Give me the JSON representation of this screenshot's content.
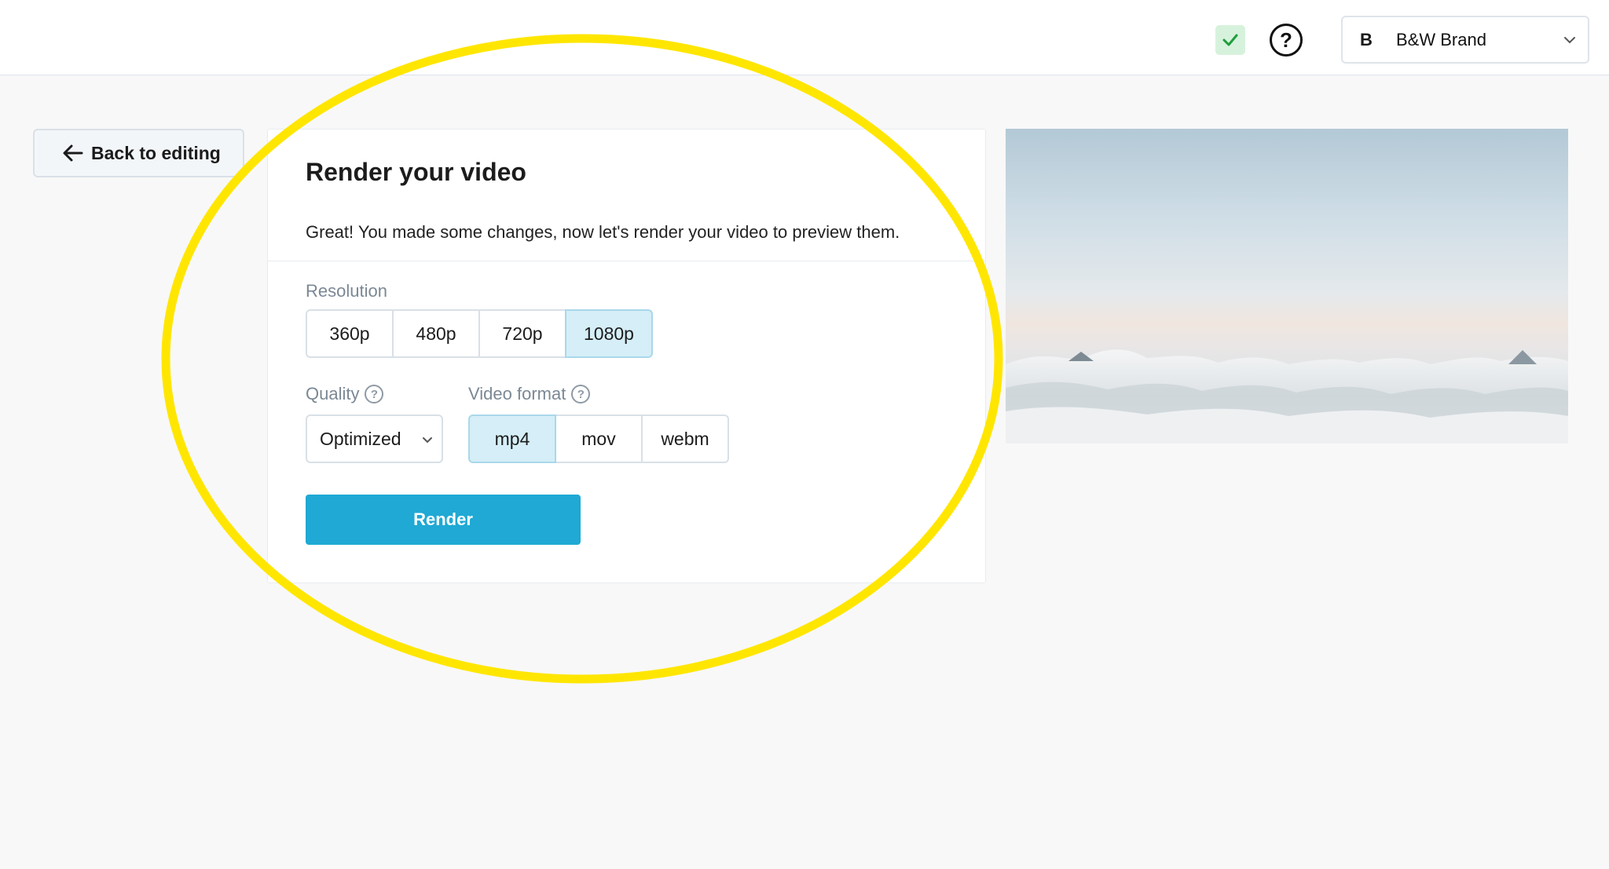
{
  "header": {
    "status_icon": "check-icon",
    "help_icon": "question-circle-icon",
    "help_glyph": "?",
    "brand": {
      "initial": "B",
      "name": "B&W Brand",
      "chevron_icon": "chevron-down-icon"
    }
  },
  "back_button": {
    "label": "Back to editing",
    "icon": "arrow-left-icon"
  },
  "render_card": {
    "title": "Render your video",
    "description": "Great! You made some changes, now let's render your video to preview them.",
    "resolution": {
      "label": "Resolution",
      "options": [
        "360p",
        "480p",
        "720p",
        "1080p"
      ],
      "selected": "1080p"
    },
    "quality": {
      "label": "Quality",
      "value": "Optimized",
      "info_glyph": "?"
    },
    "video_format": {
      "label": "Video format",
      "options": [
        "mp4",
        "mov",
        "webm"
      ],
      "selected": "mp4",
      "info_glyph": "?"
    },
    "render_label": "Render"
  },
  "colors": {
    "accent": "#1fa9d4",
    "selected_segment": "#d5eef7",
    "highlight_ring": "#ffe600",
    "status_badge": "#d7f2dc",
    "status_check": "#1e9e3e"
  }
}
